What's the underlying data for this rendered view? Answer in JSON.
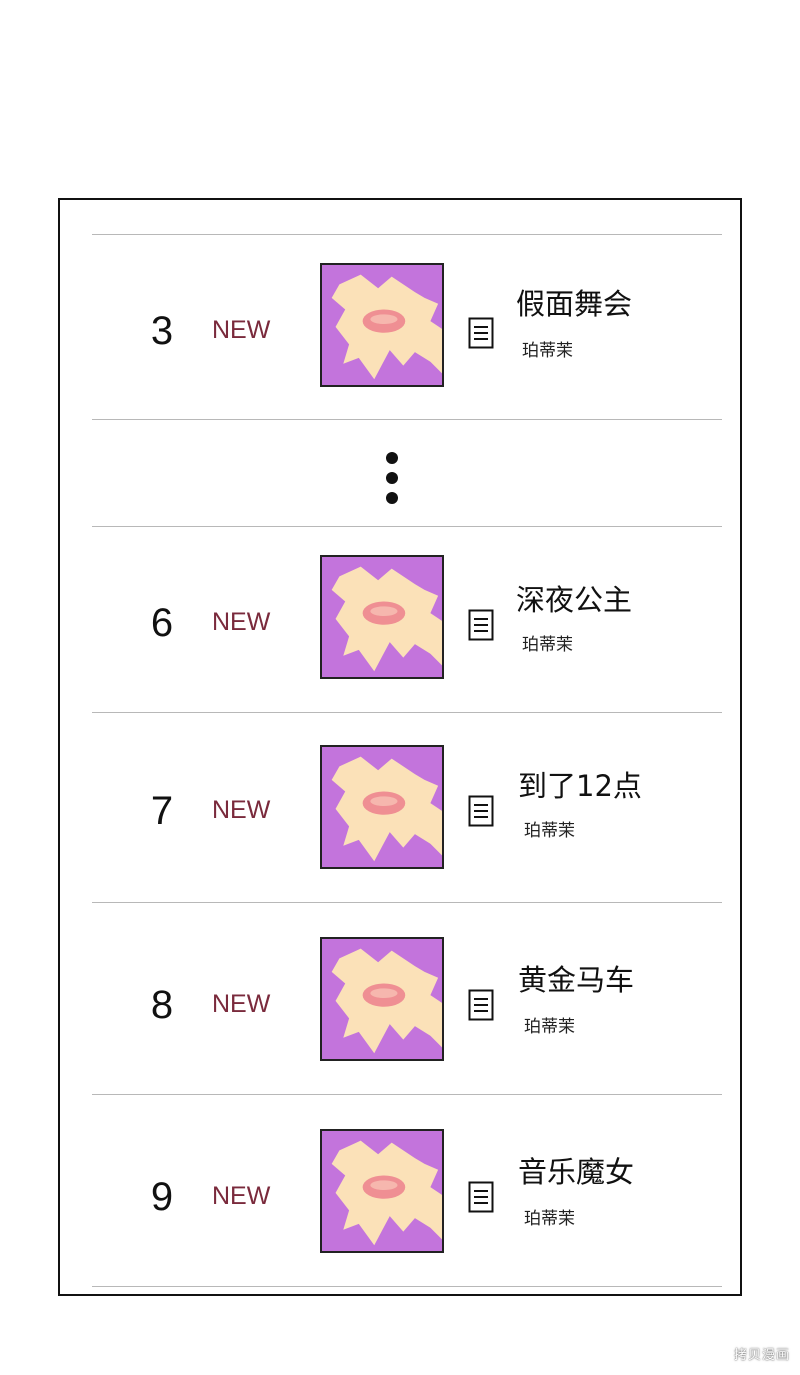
{
  "colors": {
    "thumb_bg": "#c374dc",
    "thumb_figure": "#fbe1b8",
    "thumb_accent": "#ef8f93",
    "badge": "#7a2a3c"
  },
  "icons": {
    "list_item": "document-lines-icon",
    "more": "vertical-ellipsis-icon"
  },
  "episodes": [
    {
      "rank": "3",
      "badge": "NEW",
      "title": "假面舞会",
      "author": "珀蒂茉"
    },
    {
      "rank": "6",
      "badge": "NEW",
      "title": "深夜公主",
      "author": "珀蒂茉"
    },
    {
      "rank": "7",
      "badge": "NEW",
      "title": "到了12点",
      "author": "珀蒂茉"
    },
    {
      "rank": "8",
      "badge": "NEW",
      "title": "黄金马车",
      "author": "珀蒂茉"
    },
    {
      "rank": "9",
      "badge": "NEW",
      "title": "音乐魔女",
      "author": "珀蒂茉"
    }
  ],
  "watermark": "拷贝漫画"
}
